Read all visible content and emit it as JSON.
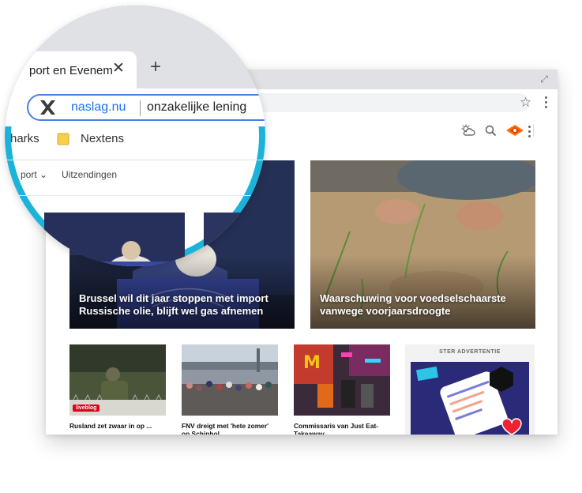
{
  "tab": {
    "title": "port en Evenem",
    "close_glyph": "✕",
    "new_tab_glyph": "+"
  },
  "omnibox": {
    "domain": "naslag.nu",
    "query": "onzakelijke lening"
  },
  "bookmarks": {
    "items": [
      "harks",
      "Nextens"
    ]
  },
  "site_nav": {
    "items": [
      "port ⌄",
      "Uitzendingen"
    ]
  },
  "icons": {
    "star": "★",
    "maximize": "⤢"
  },
  "headlines": {
    "left": "Brussel wil dit jaar stoppen met import Russische olie, blijft wel gas afnemen",
    "right": "Waarschuwing voor voedselschaarste vanwege voorjaarsdroogte"
  },
  "cards": [
    {
      "title": "Rusland zet zwaar in op ...",
      "badge": "liveblog"
    },
    {
      "title": "FNV dreigt met 'hete zomer' op Schiphol...",
      "badge": ""
    },
    {
      "title": "Commissaris van Just Eat-Takeaway...",
      "badge": ""
    }
  ],
  "ad": {
    "label": "STER ADVERTENTIE"
  },
  "colors": {
    "magnifier_ring": "#1bb3d9",
    "omnibox_border": "#4a7fe0",
    "domain_link": "#1a73e8",
    "npo_orange": "#ff6d00",
    "live_badge": "#e0001b"
  }
}
